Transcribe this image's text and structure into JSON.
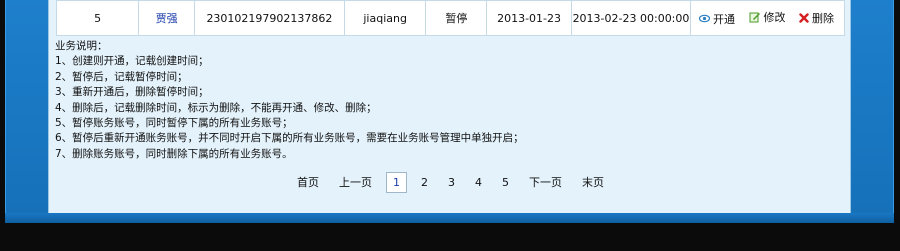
{
  "row": {
    "index": "5",
    "name": "贾强",
    "id_number": "230102197902137862",
    "account": "jiaqiang",
    "status": "暂停",
    "created_date": "2013-01-23",
    "paused_time": "2013-02-23 00:00:00",
    "actions": {
      "open": "开通",
      "edit": "修改",
      "delete": "删除"
    }
  },
  "notes": {
    "title": "业务说明：",
    "lines": [
      "1、创建则开通，记载创建时间；",
      "2、暂停后，记载暂停时间；",
      "3、重新开通后，删除暂停时间；",
      "4、删除后，记载删除时间，标示为删除，不能再开通、修改、删除；",
      "5、暂停账务账号，同时暂停下属的所有业务账号；",
      "6、暂停后重新开通账务账号，并不同时开启下属的所有业务账号，需要在业务账号管理中单独开启；",
      "7、删除账务账号，同时删除下属的所有业务账号。"
    ]
  },
  "pager": {
    "first": "首页",
    "prev": "上一页",
    "pages": [
      "1",
      "2",
      "3",
      "4",
      "5"
    ],
    "current": "1",
    "next": "下一页",
    "last": "末页"
  },
  "colors": {
    "frame": "#1e7fcc",
    "panel": "#e4f2fb",
    "link": "#1a3ca8",
    "delete_icon": "#d42020",
    "edit_icon": "#4a9a2a",
    "eye_icon": "#2a7fc2"
  }
}
